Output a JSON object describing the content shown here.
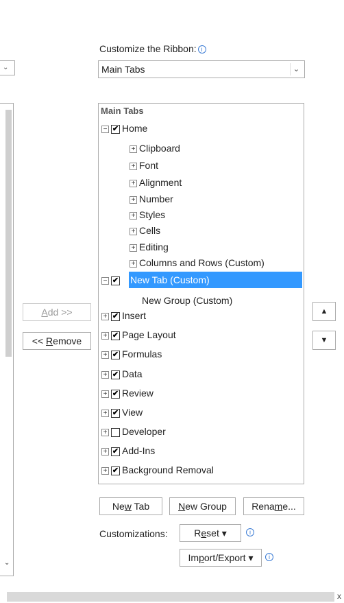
{
  "header": {
    "label": "Customize the Ribbon:",
    "info_glyph": "i"
  },
  "dropdown": {
    "value": "Main Tabs",
    "arrow_glyph": "⌄"
  },
  "left": {
    "top_mark": "⌄",
    "bottom_mark": "⌄"
  },
  "tree": {
    "header": "Main Tabs",
    "check_glyph": "✔",
    "expand_glyph": "+",
    "collapse_glyph": "−",
    "rows": [
      {
        "label": "Home"
      },
      {
        "label": "Clipboard"
      },
      {
        "label": "Font"
      },
      {
        "label": "Alignment"
      },
      {
        "label": "Number"
      },
      {
        "label": "Styles"
      },
      {
        "label": "Cells"
      },
      {
        "label": "Editing"
      },
      {
        "label": "Columns and Rows (Custom)"
      },
      {
        "label": "New Tab (Custom)"
      },
      {
        "label": "New Group (Custom)"
      },
      {
        "label": "Insert"
      },
      {
        "label": "Page Layout"
      },
      {
        "label": "Formulas"
      },
      {
        "label": "Data"
      },
      {
        "label": "Review"
      },
      {
        "label": "View"
      },
      {
        "label": "Developer"
      },
      {
        "label": "Add-Ins"
      },
      {
        "label": "Background Removal"
      }
    ]
  },
  "buttons": {
    "add": {
      "prefix": "",
      "mnemonic": "A",
      "suffix": "dd >>"
    },
    "remove": {
      "prefix": "<< ",
      "mnemonic": "R",
      "suffix": "emove"
    },
    "move_up_glyph": "▲",
    "move_down_glyph": "▼",
    "new_tab": {
      "prefix": "Ne",
      "mnemonic": "w",
      "suffix": " Tab"
    },
    "new_group": {
      "prefix": "",
      "mnemonic": "N",
      "suffix": "ew Group"
    },
    "rename": {
      "prefix": "Rena",
      "mnemonic": "m",
      "suffix": "e..."
    },
    "reset": {
      "prefix": "R",
      "mnemonic": "e",
      "suffix": "set ▾"
    },
    "import_export": {
      "prefix": "Im",
      "mnemonic": "p",
      "suffix": "ort/Export ▾"
    }
  },
  "customizations_label": "Customizations:",
  "scrollbar": {
    "close_glyph": "x"
  },
  "colors": {
    "selection": "#3399ff",
    "info": "#3a7bd5"
  }
}
